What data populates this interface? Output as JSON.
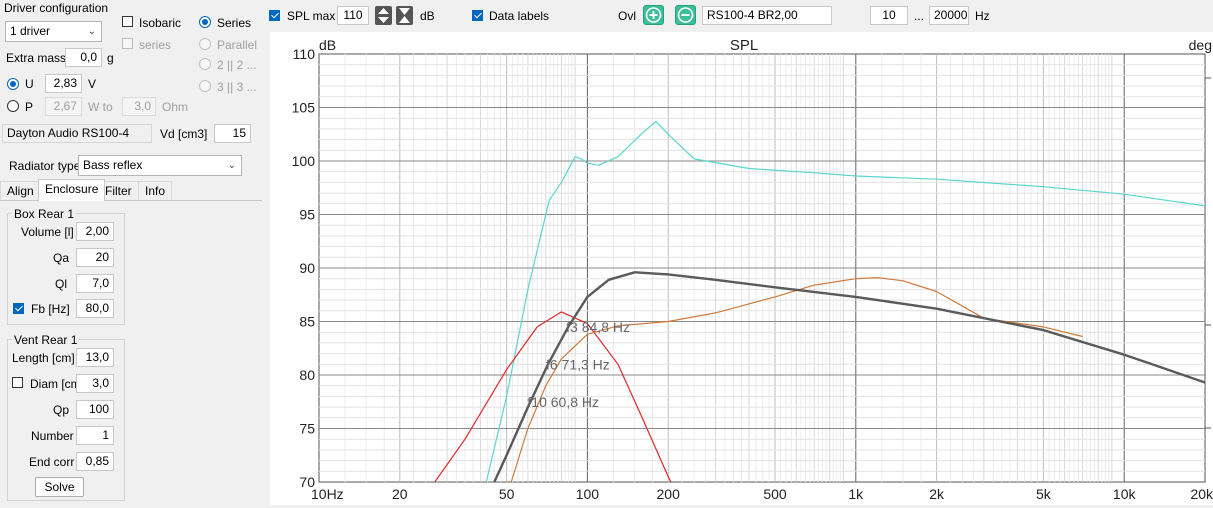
{
  "left_panel": {
    "driver_config_title": "Driver configuration",
    "driver_count": "1 driver",
    "isobaric_label": "Isobaric",
    "series_chk_label": "series",
    "series_radio_label": "Series",
    "parallel_label": "Parallel",
    "two_two_label": "2 || 2 ...",
    "three_three_label": "3 || 3 ...",
    "extra_mass_label": "Extra mass",
    "extra_mass_value": "0,0",
    "extra_mass_unit": "g",
    "u_label": "U",
    "u_value": "2,83",
    "u_unit": "V",
    "p_label": "P",
    "p_value": "2,67",
    "w_to_label": "W to",
    "ohm_value": "3,0",
    "ohm_unit": "Ohm",
    "driver_name": "Dayton Audio RS100-4",
    "vd_label": "Vd [cm3]",
    "vd_value": "15",
    "radiator_type_label": "Radiator type",
    "radiator_type_value": "Bass reflex",
    "tabs": [
      "Align",
      "Enclosure",
      "Filter",
      "Info"
    ],
    "box": {
      "title": "Box Rear 1",
      "volume_label": "Volume [l]",
      "volume_value": "2,00",
      "qa_label": "Qa",
      "qa_value": "20",
      "ql_label": "Ql",
      "ql_value": "7,0",
      "fb_label": "Fb [Hz]",
      "fb_value": "80,0"
    },
    "vent": {
      "title": "Vent Rear 1",
      "length_label": "Length [cm]",
      "length_value": "13,0",
      "diam_label": "Diam [cm]",
      "diam_value": "3,0",
      "qp_label": "Qp",
      "qp_value": "100",
      "number_label": "Number",
      "number_value": "1",
      "endcorr_label": "End corr",
      "endcorr_value": "0,85",
      "solve_label": "Solve"
    }
  },
  "toolbar": {
    "spl_max_label": "SPL max",
    "spl_max_value": "110",
    "db_unit": "dB",
    "data_labels_label": "Data labels",
    "ovl_label": "Ovl",
    "overlay_name": "RS100-4 BR2,00",
    "freq_min": "10",
    "freq_sep": "...",
    "freq_max": "20000",
    "hz_unit": "Hz"
  },
  "colors": {
    "cyan": "#5ad6cf",
    "red": "#e0262a",
    "orange": "#cf7a3c",
    "dark": "#5a5a5a",
    "accent": "#0067c0",
    "green": "#3bbf98"
  },
  "chart_data": {
    "type": "line",
    "title": "SPL",
    "ylabel_left": "dB",
    "ylabel_right": "deg",
    "xscale": "log",
    "xlim": [
      10,
      20000
    ],
    "ylim": [
      70,
      110
    ],
    "grid": true,
    "x_ticks": [
      "10Hz",
      "20",
      "50",
      "100",
      "200",
      "500",
      "1k",
      "2k",
      "5k",
      "10k",
      "20k"
    ],
    "y_ticks": [
      "70",
      "75",
      "80",
      "85",
      "90",
      "95",
      "100",
      "105",
      "110"
    ],
    "series": [
      {
        "color": "#5ad6cf",
        "x": [
          42,
          50,
          60,
          72,
          80,
          90,
          95,
          100,
          110,
          130,
          160,
          180,
          200,
          250,
          400,
          700,
          1000,
          2000,
          5000,
          10000,
          20000
        ],
        "y": [
          70,
          78,
          88,
          96.3,
          98,
          100.4,
          100.2,
          99.8,
          99.6,
          100.4,
          102.6,
          103.7,
          102.5,
          100.2,
          99.3,
          98.9,
          98.6,
          98.3,
          97.6,
          96.9,
          95.8
        ]
      },
      {
        "color": "#e0262a",
        "x": [
          27,
          35,
          50,
          65,
          80,
          100,
          130,
          160,
          200,
          220
        ],
        "y": [
          70,
          74,
          80.5,
          84.5,
          85.9,
          84.8,
          81,
          76,
          70.5,
          68.5
        ]
      },
      {
        "color": "#cf7a3c",
        "x": [
          52,
          60,
          70,
          80,
          100,
          130,
          200,
          300,
          500,
          700,
          1000,
          1200,
          1500,
          2000,
          3000,
          5000,
          7000
        ],
        "y": [
          70,
          75,
          79,
          81.5,
          83.8,
          84.6,
          85,
          85.8,
          87.3,
          88.4,
          89,
          89.1,
          88.8,
          87.8,
          85.3,
          84.5,
          83.6
        ]
      },
      {
        "color": "#5a5a5a",
        "x": [
          45,
          50,
          60,
          71.3,
          84.8,
          100,
          120,
          150,
          200,
          300,
          500,
          1000,
          2000,
          5000,
          10000,
          20000
        ],
        "y": [
          70,
          72.5,
          77,
          81,
          84.5,
          87.3,
          88.9,
          89.6,
          89.4,
          88.9,
          88.2,
          87.3,
          86.2,
          84.2,
          81.9,
          79.3
        ]
      }
    ],
    "annotations": [
      {
        "text": "f3 84,8 Hz",
        "x": 84.8,
        "y": 84.5
      },
      {
        "text": "f6 71,3 Hz",
        "x": 71.3,
        "y": 81
      },
      {
        "text": "f10 60,8 Hz",
        "x": 60.8,
        "y": 77.5
      }
    ]
  }
}
